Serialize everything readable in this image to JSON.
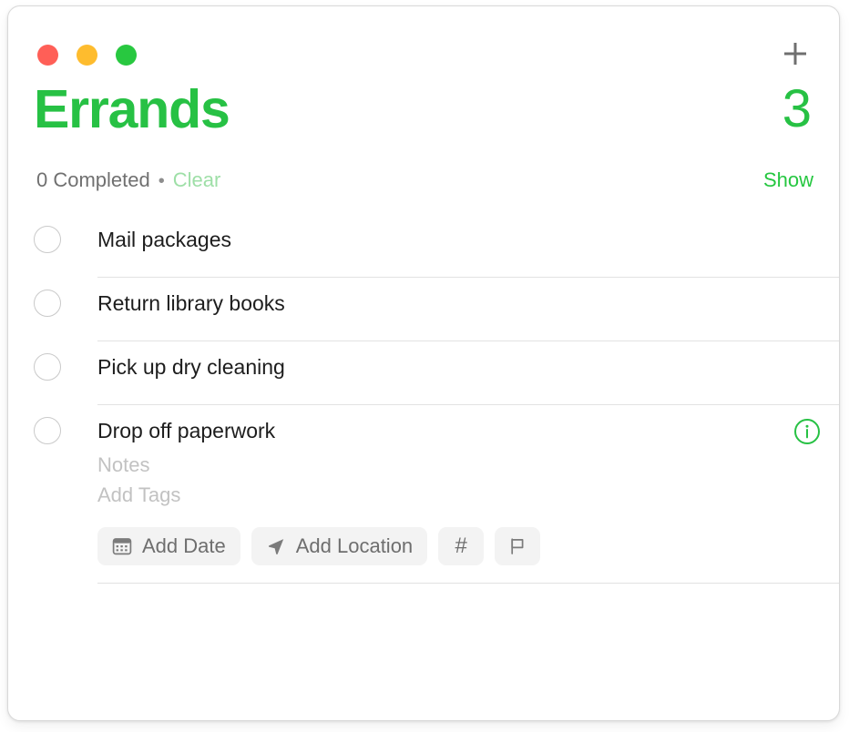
{
  "window": {
    "traffic_lights": [
      {
        "name": "close",
        "color": "#ff5f57"
      },
      {
        "name": "minimize",
        "color": "#febc2e"
      },
      {
        "name": "maximize",
        "color": "#28c840"
      }
    ],
    "add_button_icon": "plus-icon"
  },
  "header": {
    "title": "Errands",
    "count": "3",
    "accent_color": "#27c144"
  },
  "status": {
    "completed_text": "0 Completed",
    "separator": "•",
    "clear_label": "Clear",
    "clear_color": "#9edfa7",
    "show_label": "Show",
    "show_color": "#25c740"
  },
  "tasks": [
    {
      "title": "Mail packages",
      "checked": false,
      "expanded": false
    },
    {
      "title": "Return library books",
      "checked": false,
      "expanded": false
    },
    {
      "title": "Pick up dry cleaning",
      "checked": false,
      "expanded": false
    },
    {
      "title": "Drop off paperwork",
      "checked": false,
      "expanded": true,
      "notes_placeholder": "Notes",
      "tags_placeholder": "Add Tags",
      "info_icon": "info-circle-icon",
      "info_color": "#27c144",
      "chips": [
        {
          "icon": "calendar-icon",
          "label": "Add Date"
        },
        {
          "icon": "navigation-icon",
          "label": "Add Location"
        },
        {
          "icon": "hashtag-icon",
          "label": "#"
        },
        {
          "icon": "flag-icon",
          "label": ""
        }
      ]
    }
  ]
}
